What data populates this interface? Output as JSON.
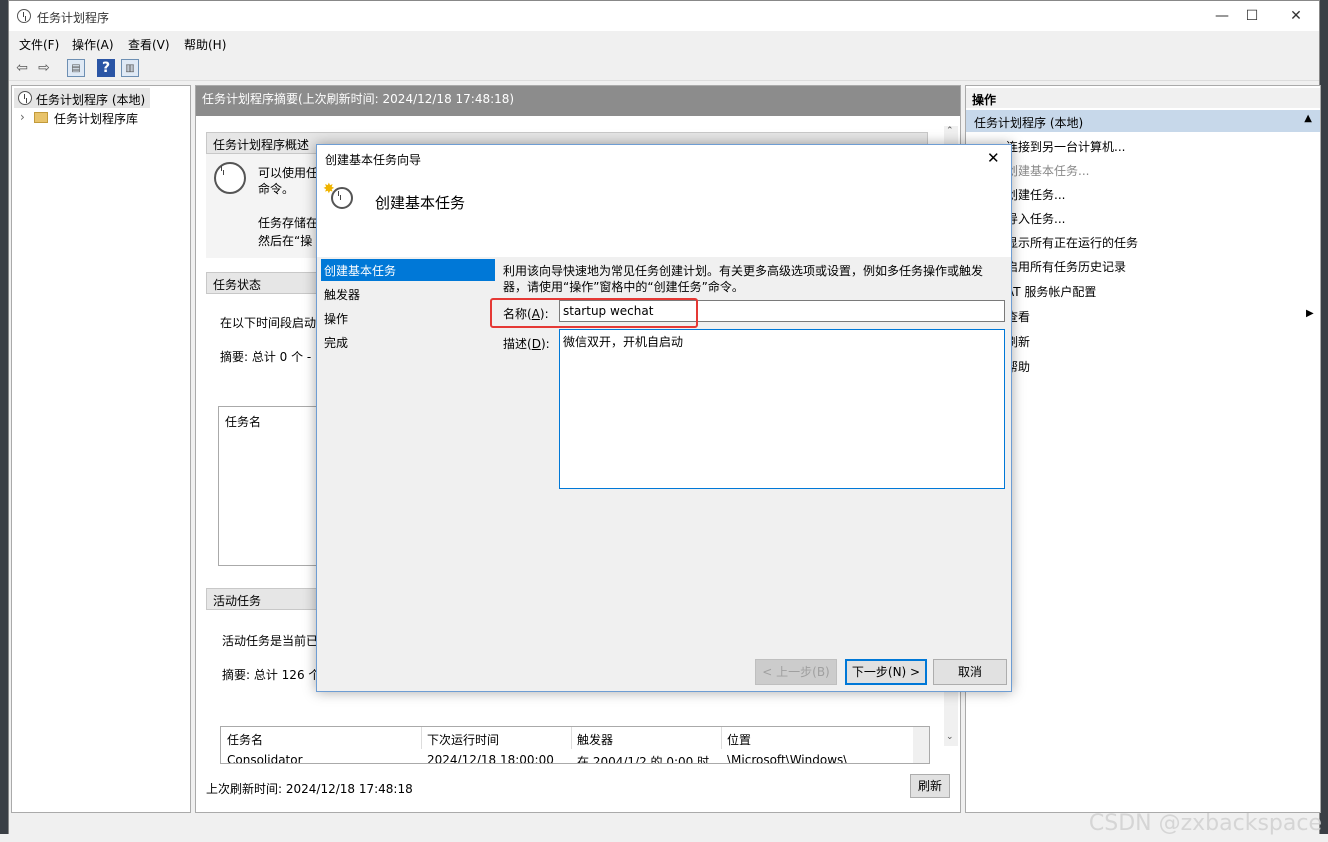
{
  "window": {
    "title": "任务计划程序",
    "controls": {
      "minimize": "—",
      "maximize": "☐",
      "close": "✕"
    }
  },
  "menubar": [
    "文件(F)",
    "操作(A)",
    "查看(V)",
    "帮助(H)"
  ],
  "toolbar": {
    "back": "⇦",
    "forward": "⇨",
    "help": "?"
  },
  "tree": {
    "root": "任务计划程序 (本地)",
    "child": "任务计划程序库"
  },
  "center": {
    "header": "任务计划程序摘要(上次刷新时间: 2024/12/18 17:48:18)",
    "overview_title": "任务计划程序概述",
    "overview_text1": "可以使用任",
    "overview_text2": "命令。",
    "overview_text3": "任务存储在",
    "overview_text4": "然后在“操",
    "status_title": "任务状态",
    "status_line": "在以下时间段启动",
    "status_summary": "摘要: 总计 0 个 - (",
    "status_col": "任务名",
    "active_title": "活动任务",
    "active_line": "活动任务是当前已",
    "active_summary": "摘要: 总计 126 个",
    "table_headers": [
      "任务名",
      "下次运行时间",
      "触发器",
      "位置"
    ],
    "table_row": [
      "Consolidator",
      "2024/12/18 18:00:00",
      "在 2004/1/2 的 0:00 时",
      "\\Microsoft\\Windows\\"
    ],
    "footer": "上次刷新时间: 2024/12/18 17:48:18",
    "refresh_button": "刷新"
  },
  "actions": {
    "header": "操作",
    "subheader": "任务计划程序 (本地)",
    "items": [
      "连接到另一台计算机...",
      "创建基本任务...",
      "创建任务...",
      "导入任务...",
      "显示所有正在运行的任务",
      "启用所有任务历史记录",
      "AT 服务帐户配置",
      "查看",
      "刷新",
      "帮助"
    ]
  },
  "dialog": {
    "title": "创建基本任务向导",
    "heading": "创建基本任务",
    "steps": [
      "创建基本任务",
      "触发器",
      "操作",
      "完成"
    ],
    "intro": "利用该向导快速地为常见任务创建计划。有关更多高级选项或设置，例如多任务操作或触发器，请使用“操作”窗格中的“创建任务”命令。",
    "name_label": "名称(",
    "name_key": "A",
    "desc_label": "描述(",
    "desc_key": "D",
    "name_value": "startup wechat",
    "desc_value": "微信双开，开机自启动",
    "btn_back": "< 上一步(B)",
    "btn_next": "下一步(N) >",
    "btn_cancel": "取消",
    "highlight_color": "#e53935"
  },
  "watermark": "CSDN @zxbackspace"
}
